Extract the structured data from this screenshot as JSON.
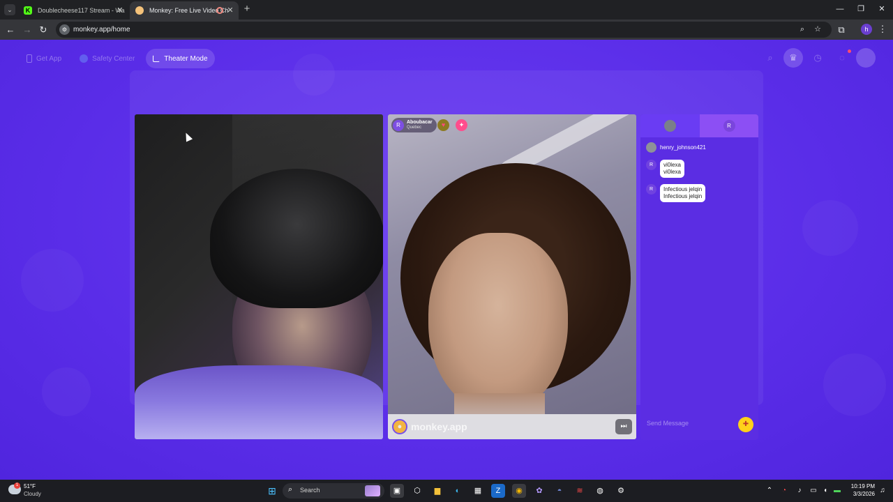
{
  "browser": {
    "tabs": [
      {
        "title": "Doublecheese117 Stream - Wa",
        "active": false
      },
      {
        "title": "Monkey: Free Live Video Ch",
        "active": true
      }
    ],
    "url": "monkey.app/home",
    "profile_initial": "h"
  },
  "app": {
    "nav": {
      "get_app": "Get App",
      "safety_center": "Safety Center",
      "theater_mode": "Theater Mode"
    },
    "peer": {
      "initial": "R",
      "name": "Aboubacar",
      "location": "Quebec"
    },
    "watermark": "monkey.app",
    "chat": {
      "tab_initial": "R",
      "messages": [
        {
          "type": "user",
          "avatar": "",
          "text": "henry_johnson421"
        },
        {
          "type": "bubble",
          "avatar": "R",
          "line1": "vi0lexa",
          "line2": "vi0lexa"
        },
        {
          "type": "bubble",
          "avatar": "R",
          "line1": "Infectious jelqin",
          "line2": "Infectious jelqin"
        }
      ],
      "input_placeholder": "Send Message"
    }
  },
  "taskbar": {
    "weather": {
      "temp": "51°F",
      "desc": "Cloudy",
      "badge": "1"
    },
    "search": "Search",
    "time": "10:19 PM",
    "date": "3/3/2026"
  }
}
